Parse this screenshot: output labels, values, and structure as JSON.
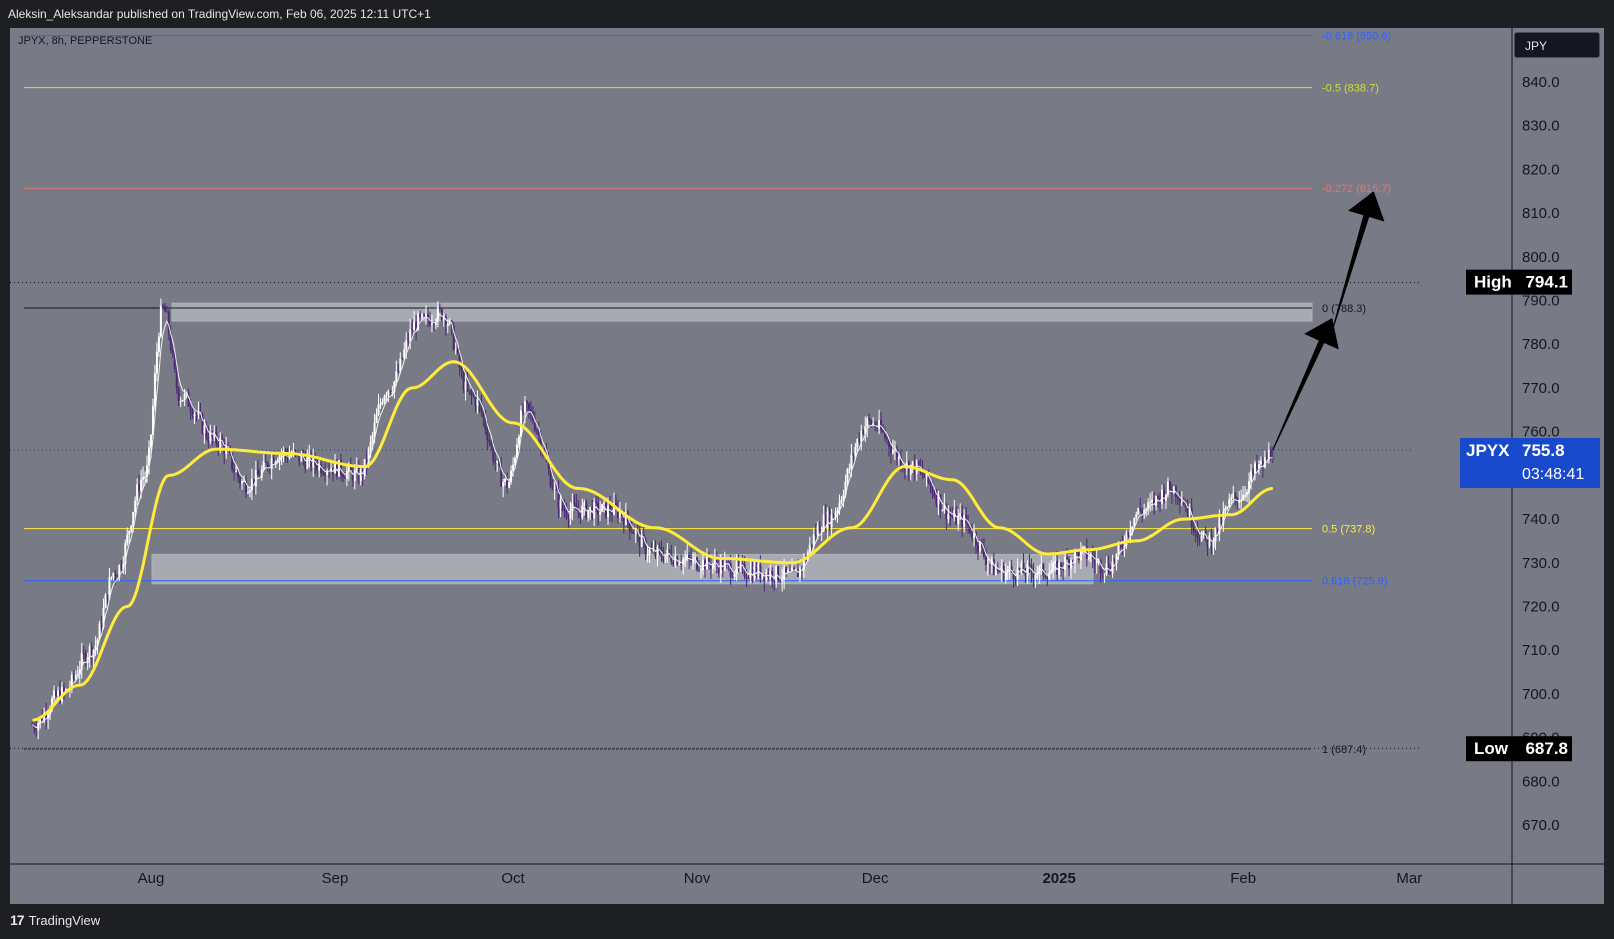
{
  "header": {
    "publish_line": "Aleksin_Aleksandar published on TradingView.com, Feb 06, 2025 12:11 UTC+1"
  },
  "footer": {
    "logo_text": "TradingView"
  },
  "chart_data": {
    "type": "candlestick",
    "symbol_line": "JPYX, 8h, PEPPERSTONE",
    "currency": "JPY",
    "ylim": [
      664,
      858
    ],
    "y_ticks": [
      670.0,
      680.0,
      690.0,
      700.0,
      710.0,
      720.0,
      730.0,
      740.0,
      750.0,
      760.0,
      770.0,
      780.0,
      790.0,
      800.0,
      810.0,
      820.0,
      830.0,
      840.0
    ],
    "x_labels": [
      {
        "label": "Aug",
        "date": "2024-08-01"
      },
      {
        "label": "Sep",
        "date": "2024-09-01"
      },
      {
        "label": "Oct",
        "date": "2024-10-01"
      },
      {
        "label": "Nov",
        "date": "2024-11-01"
      },
      {
        "label": "Dec",
        "date": "2024-12-01"
      },
      {
        "label": "2025",
        "date": "2025-01-01"
      },
      {
        "label": "Feb",
        "date": "2025-02-01"
      },
      {
        "label": "Mar",
        "date": "2025-03-01"
      }
    ],
    "fib_levels": [
      {
        "label": "-0.618 (850.6)",
        "value": 850.6,
        "color": "#2962ff"
      },
      {
        "label": "-0.5 (838.7)",
        "value": 838.7,
        "color": "#cddc39"
      },
      {
        "label": "-0.272 (815.7)",
        "value": 815.7,
        "color": "#e57373"
      },
      {
        "label": "0 (788.3)",
        "value": 788.3,
        "color": "#131722"
      },
      {
        "label": "0.5 (737.8)",
        "value": 737.8,
        "color": "#ffeb3b"
      },
      {
        "label": "0.618 (725.9)",
        "value": 725.9,
        "color": "#2962ff"
      },
      {
        "label": "1 (687.4)",
        "value": 687.4,
        "color": "#131722"
      }
    ],
    "zones": [
      {
        "from": 785.3,
        "to": 789.4
      },
      {
        "from": 725.2,
        "to": 731.9
      }
    ],
    "markers": {
      "high": {
        "label": "High",
        "value": "794.1"
      },
      "low": {
        "label": "Low",
        "value": "687.8"
      },
      "last": {
        "symbol": "JPYX",
        "value": "755.8",
        "countdown": "03:48:41"
      }
    },
    "price_path": [
      [
        "2024-07-12",
        693
      ],
      [
        "2024-07-17",
        700
      ],
      [
        "2024-07-22",
        710
      ],
      [
        "2024-07-26",
        728
      ],
      [
        "2024-07-31",
        750
      ],
      [
        "2024-08-03",
        788
      ],
      [
        "2024-08-06",
        768
      ],
      [
        "2024-08-12",
        758
      ],
      [
        "2024-08-17",
        748
      ],
      [
        "2024-08-23",
        755
      ],
      [
        "2024-08-31",
        752
      ],
      [
        "2024-09-05",
        750
      ],
      [
        "2024-09-10",
        770
      ],
      [
        "2024-09-15",
        785
      ],
      [
        "2024-09-19",
        787
      ],
      [
        "2024-09-24",
        768
      ],
      [
        "2024-09-30",
        748
      ],
      [
        "2024-10-03",
        765
      ],
      [
        "2024-10-10",
        742
      ],
      [
        "2024-10-18",
        742
      ],
      [
        "2024-10-25",
        732
      ],
      [
        "2024-11-02",
        730
      ],
      [
        "2024-11-10",
        728
      ],
      [
        "2024-11-17",
        727
      ],
      [
        "2024-11-23",
        740
      ],
      [
        "2024-11-30",
        762
      ],
      [
        "2024-12-07",
        752
      ],
      [
        "2024-12-15",
        740
      ],
      [
        "2024-12-22",
        728
      ],
      [
        "2024-12-30",
        728
      ],
      [
        "2025-01-05",
        732
      ],
      [
        "2025-01-09",
        729
      ],
      [
        "2025-01-15",
        742
      ],
      [
        "2025-01-20",
        747
      ],
      [
        "2025-01-26",
        735
      ],
      [
        "2025-01-31",
        745
      ],
      [
        "2025-02-04",
        752
      ],
      [
        "2025-02-06",
        755.8
      ]
    ],
    "ema_path": [
      [
        "2024-07-12",
        694
      ],
      [
        "2024-07-20",
        702
      ],
      [
        "2024-07-28",
        720
      ],
      [
        "2024-08-04",
        750
      ],
      [
        "2024-08-12",
        756
      ],
      [
        "2024-08-24",
        755
      ],
      [
        "2024-09-06",
        752
      ],
      [
        "2024-09-14",
        770
      ],
      [
        "2024-09-21",
        776
      ],
      [
        "2024-10-01",
        762
      ],
      [
        "2024-10-12",
        747
      ],
      [
        "2024-10-25",
        738
      ],
      [
        "2024-11-05",
        731
      ],
      [
        "2024-11-17",
        730
      ],
      [
        "2024-11-27",
        738
      ],
      [
        "2024-12-06",
        752
      ],
      [
        "2024-12-14",
        749
      ],
      [
        "2024-12-22",
        738
      ],
      [
        "2024-12-30",
        732
      ],
      [
        "2025-01-06",
        733
      ],
      [
        "2025-01-14",
        735
      ],
      [
        "2025-01-22",
        740
      ],
      [
        "2025-01-30",
        741
      ],
      [
        "2025-02-06",
        747
      ]
    ],
    "projection": [
      [
        "2025-02-06",
        755.8
      ],
      [
        "2025-02-16",
        786
      ],
      [
        "2025-02-23",
        815
      ]
    ],
    "colors": {
      "background": "#787b86",
      "up": "#ffffff",
      "down": "#4a2a73",
      "ema": "#ffeb3b",
      "label_bg": "#000000",
      "last_bg": "#1848cc"
    }
  }
}
